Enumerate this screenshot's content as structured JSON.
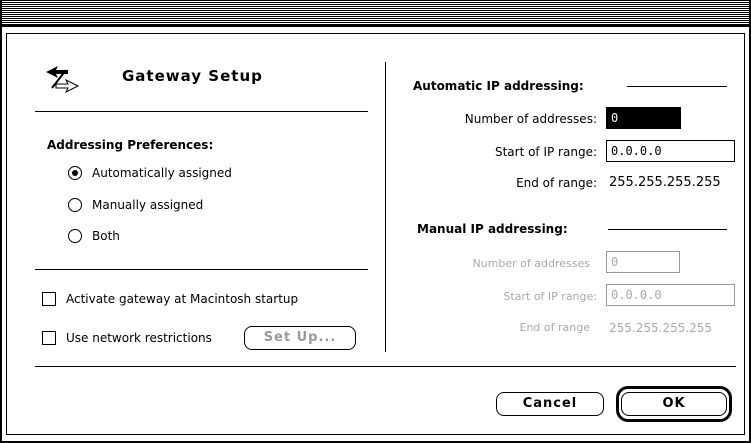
{
  "dialog": {
    "title": "Gateway Setup"
  },
  "addressing": {
    "heading": "Addressing Preferences:",
    "options": [
      {
        "label": "Automatically assigned",
        "selected": true
      },
      {
        "label": "Manually assigned",
        "selected": false
      },
      {
        "label": "Both",
        "selected": false
      }
    ]
  },
  "options": {
    "activate_label": "Activate gateway at Macintosh startup",
    "activate_checked": false,
    "restrictions_label": "Use network restrictions",
    "restrictions_checked": false,
    "setup_button": "Set Up..."
  },
  "automatic": {
    "heading": "Automatic IP addressing:",
    "count_label": "Number of addresses:",
    "count_value": "0",
    "start_label": "Start of IP range:",
    "start_value": "0.0.0.0",
    "end_label": "End of range:",
    "end_value": "255.255.255.255"
  },
  "manual": {
    "heading": "Manual IP addressing:",
    "count_label": "Number of addresses",
    "count_value": "0",
    "start_label": "Start of IP range:",
    "start_value": "0.0.0.0",
    "end_label": "End of range",
    "end_value": "255.255.255.255"
  },
  "buttons": {
    "cancel": "Cancel",
    "ok": "OK"
  }
}
